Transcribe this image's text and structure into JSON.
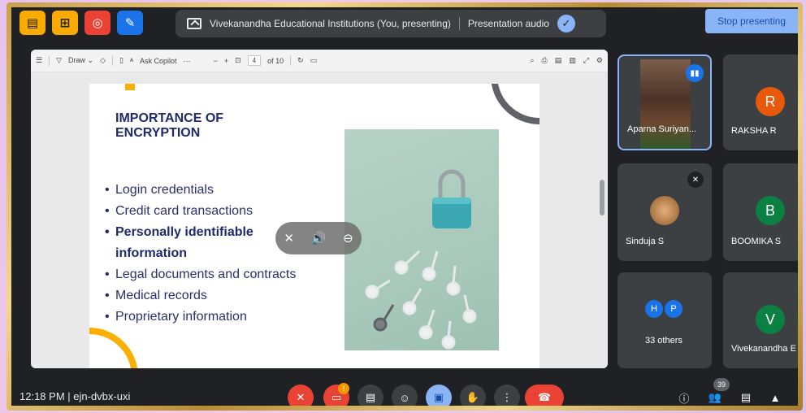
{
  "topbar": {
    "presenting_text": "Vivekanandha Educational Institutions (You, presenting)",
    "audio_label": "Presentation audio",
    "stop_label": "Stop presenting"
  },
  "pdf_toolbar": {
    "draw_label": "Draw",
    "copilot_label": "Ask Copilot",
    "page_current": "4",
    "page_total": "of 10"
  },
  "slide": {
    "title": "IMPORTANCE OF ENCRYPTION",
    "bullets": [
      "Login credentials",
      "Credit card transactions",
      "Personally identifiable",
      "information",
      "Legal documents and contracts",
      "Medical records",
      "Proprietary information"
    ]
  },
  "participants": [
    {
      "name": "Aparna Suriyan...",
      "initial": ""
    },
    {
      "name": "RAKSHA R",
      "initial": "R",
      "color": "#e8590c"
    },
    {
      "name": "Sinduja S",
      "initial": ""
    },
    {
      "name": "BOOMIKA S",
      "initial": "B",
      "color": "#0b8043"
    },
    {
      "name": "33 others",
      "initial_a": "H",
      "initial_b": "P"
    },
    {
      "name": "Vivekanandha E",
      "initial": "V",
      "color": "#0b8043"
    }
  ],
  "bottombar": {
    "time": "12:18 PM",
    "meeting_code": "ejn-dvbx-uxi",
    "participant_count": "39",
    "notification_count": "!"
  },
  "colors": {
    "accent": "#8ab4f8",
    "slide_title": "#1f2a6b",
    "end_call": "#ea4335"
  }
}
